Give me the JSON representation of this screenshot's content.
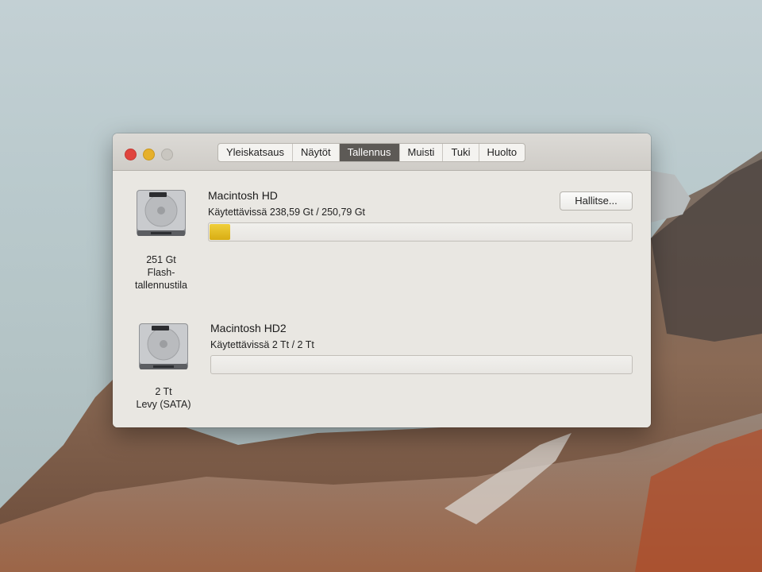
{
  "window": {
    "tabs": [
      {
        "label": "Yleiskatsaus"
      },
      {
        "label": "Näytöt"
      },
      {
        "label": "Tallennus"
      },
      {
        "label": "Muisti"
      },
      {
        "label": "Tuki"
      },
      {
        "label": "Huolto"
      }
    ],
    "active_tab": "Tallennus"
  },
  "volumes": [
    {
      "name": "Macintosh HD",
      "available_text": "Käytettävissä 238,59 Gt / 250,79 Gt",
      "capacity_label": "251 Gt",
      "type_label_1": "Flash-",
      "type_label_2": "tallennustila",
      "used_fraction": 0.049,
      "icon": "internal-drive-icon"
    },
    {
      "name": "Macintosh HD2",
      "available_text": "Käytettävissä 2 Tt / 2 Tt",
      "capacity_label": "2 Tt",
      "type_label_1": "Levy (SATA)",
      "used_fraction": 0.0,
      "icon": "internal-drive-icon"
    }
  ],
  "manage_button_label": "Hallitse...",
  "colors": {
    "used_bar": "#e2b91f",
    "active_tab": "#5d5a56",
    "close": "#e0443e",
    "minimize": "#e6b02a"
  }
}
